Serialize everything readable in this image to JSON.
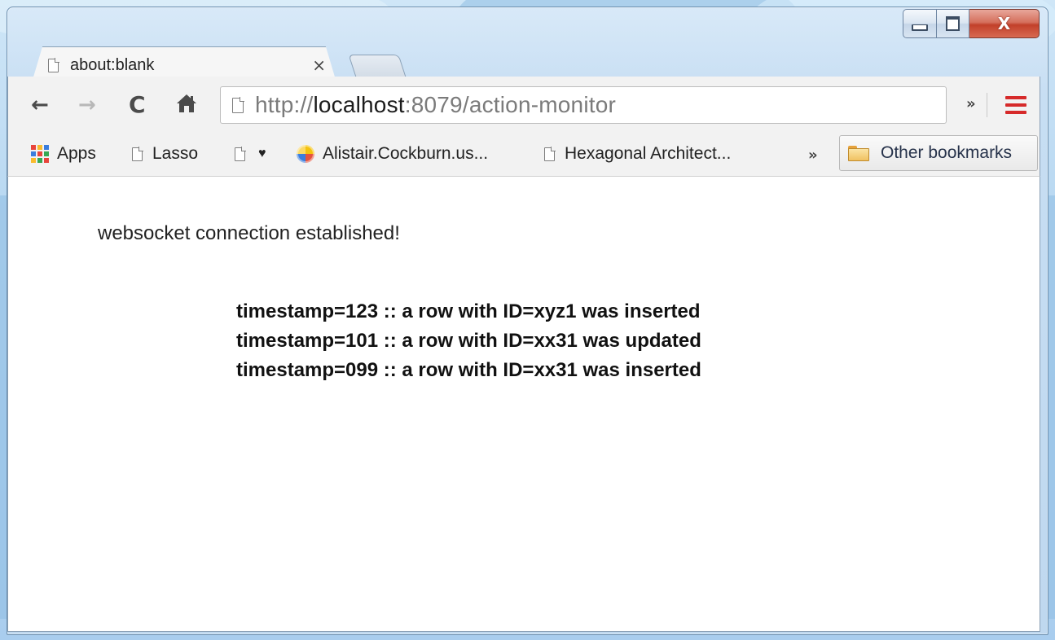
{
  "window": {
    "buttons": {
      "minimize": "minimize",
      "maximize": "maximize",
      "close": "X"
    }
  },
  "tabs": [
    {
      "title": "about:blank",
      "close": "×",
      "icon": "document-icon"
    }
  ],
  "toolbar": {
    "back_icon": "←",
    "forward_icon": "→",
    "reload_icon": "C",
    "home_icon": "home-icon",
    "url_prefix": "http://",
    "url_host": "localhost",
    "url_suffix": ":8079/action-monitor",
    "extensions_chevron": "»",
    "menu_icon": "hamburger-menu-icon"
  },
  "bookmarks": {
    "items": [
      {
        "label": "Apps",
        "icon": "apps-grid-icon"
      },
      {
        "label": "Lasso",
        "icon": "document-icon"
      },
      {
        "label": "♥",
        "icon": "document-icon"
      },
      {
        "label": "Alistair.Cockburn.us...",
        "icon": "globe-icon"
      },
      {
        "label": "Hexagonal Architect...",
        "icon": "document-icon"
      }
    ],
    "overflow": "»",
    "other": {
      "label": "Other bookmarks",
      "icon": "folder-icon"
    }
  },
  "page": {
    "status": "websocket connection established!",
    "events": [
      "timestamp=123 :: a row with ID=xyz1 was inserted",
      "timestamp=101 :: a row with ID=xx31 was updated",
      "timestamp=099 :: a row with ID=xx31 was inserted"
    ]
  },
  "colors": {
    "menu_red": "#d62a2a",
    "close_button": "#c2402a",
    "frame_blue": "#bfd8ef"
  }
}
